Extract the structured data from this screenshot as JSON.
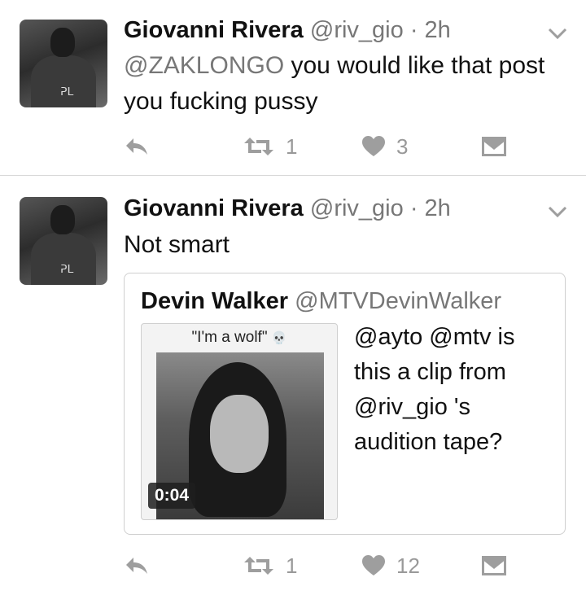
{
  "tweets": [
    {
      "name": "Giovanni Rivera",
      "handle": "@riv_gio",
      "separator": "·",
      "time": "2h",
      "text_mention": "@ZAKLONGO",
      "text_rest": " you would like that post you fucking pussy",
      "retweet_count": "1",
      "like_count": "3"
    },
    {
      "name": "Giovanni Rivera",
      "handle": "@riv_gio",
      "separator": "·",
      "time": "2h",
      "text": "Not smart",
      "retweet_count": "1",
      "like_count": "12",
      "quote": {
        "name": "Devin Walker",
        "handle": "@MTVDevinWalker",
        "media_caption": "\"I'm a wolf\"",
        "media_caption_emoji": "💀",
        "media_duration": "0:04",
        "text": "@ayto @mtv is this a clip from @riv_gio 's audition tape?"
      }
    }
  ],
  "icons": [
    "avatar",
    "chevron-down-icon",
    "reply-icon",
    "retweet-icon",
    "heart-icon",
    "direct-message-icon",
    "skull-emoji"
  ],
  "colors": {
    "text": "#111111",
    "secondary": "#777777",
    "icon": "#9e9e9e",
    "divider": "#d8d8d8"
  }
}
